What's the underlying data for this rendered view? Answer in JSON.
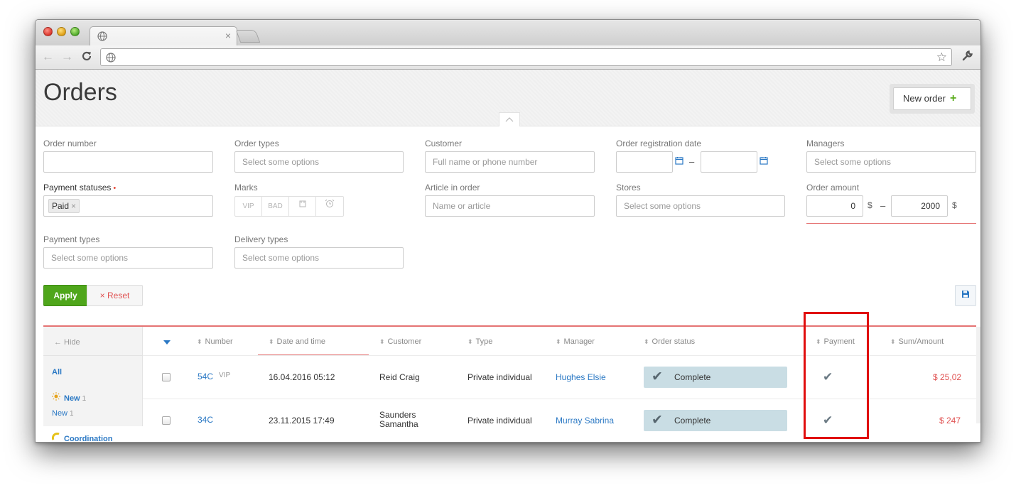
{
  "browser": {
    "tab_close": "×",
    "icons": {
      "back": "arrow-left-icon",
      "forward": "arrow-right-icon",
      "reload": "reload-icon",
      "star": "star-icon",
      "wrench": "wrench-icon",
      "globe": "globe-icon"
    },
    "glyphs": {
      "back": "←",
      "forward": "→",
      "reload": "C",
      "star": "☆",
      "wrench": "🔧"
    }
  },
  "header": {
    "title": "Orders",
    "new_order_label": "New order",
    "new_order_plus": "+",
    "collapse_glyph": "︿"
  },
  "filters": {
    "order_number": {
      "label": "Order number",
      "value": ""
    },
    "order_types": {
      "label": "Order types",
      "placeholder": "Select some options"
    },
    "customer": {
      "label": "Customer",
      "placeholder": "Full name or phone number"
    },
    "registration_date": {
      "label": "Order registration date",
      "dash": "–"
    },
    "managers": {
      "label": "Managers",
      "placeholder": "Select some options"
    },
    "payment_statuses": {
      "label": "Payment statuses",
      "required_dot": "•",
      "selected": "Paid",
      "remove": "×"
    },
    "marks": {
      "label": "Marks",
      "items": [
        "VIP",
        "BAD",
        "",
        ""
      ]
    },
    "article": {
      "label": "Article in order",
      "placeholder": "Name or article"
    },
    "stores": {
      "label": "Stores",
      "placeholder": "Select some options"
    },
    "order_amount": {
      "label": "Order amount",
      "from": "0",
      "to": "2000",
      "currency": "$",
      "dash": "–"
    },
    "payment_types": {
      "label": "Payment types",
      "placeholder": "Select some options"
    },
    "delivery_types": {
      "label": "Delivery types",
      "placeholder": "Select some options"
    }
  },
  "actions": {
    "apply": "Apply",
    "reset": "Reset",
    "reset_icon": "×"
  },
  "sidebar": {
    "hide": "← Hide",
    "items": [
      {
        "label": "All",
        "count": ""
      },
      {
        "label": "New",
        "count": "1",
        "icon": "sun-icon"
      },
      {
        "label": "New",
        "count": "1"
      },
      {
        "label": "Coordination",
        "count": "",
        "icon": "phone-icon"
      }
    ]
  },
  "table": {
    "columns": [
      "Number",
      "Date and time",
      "Customer",
      "Type",
      "Manager",
      "Order status",
      "Payment",
      "Sum/Amount"
    ],
    "rows": [
      {
        "number": "54C",
        "mark": "VIP",
        "date": "16.04.2016 05:12",
        "customer": "Reid Craig",
        "type": "Private individual",
        "manager": "Hughes Elsie",
        "status": "Complete",
        "paid": true,
        "sum": "$ 25,02"
      },
      {
        "number": "34C",
        "mark": "",
        "date": "23.11.2015 17:49",
        "customer": "Saunders Samantha",
        "type": "Private individual",
        "manager": "Murray Sabrina",
        "status": "Complete",
        "paid": true,
        "sum": "$ 247"
      }
    ]
  },
  "colors": {
    "accent": "#2a78c4",
    "apply_green": "#4fa61b",
    "danger": "#e05252",
    "status_bg": "#c9dde4",
    "highlight": "#e00d0d"
  }
}
